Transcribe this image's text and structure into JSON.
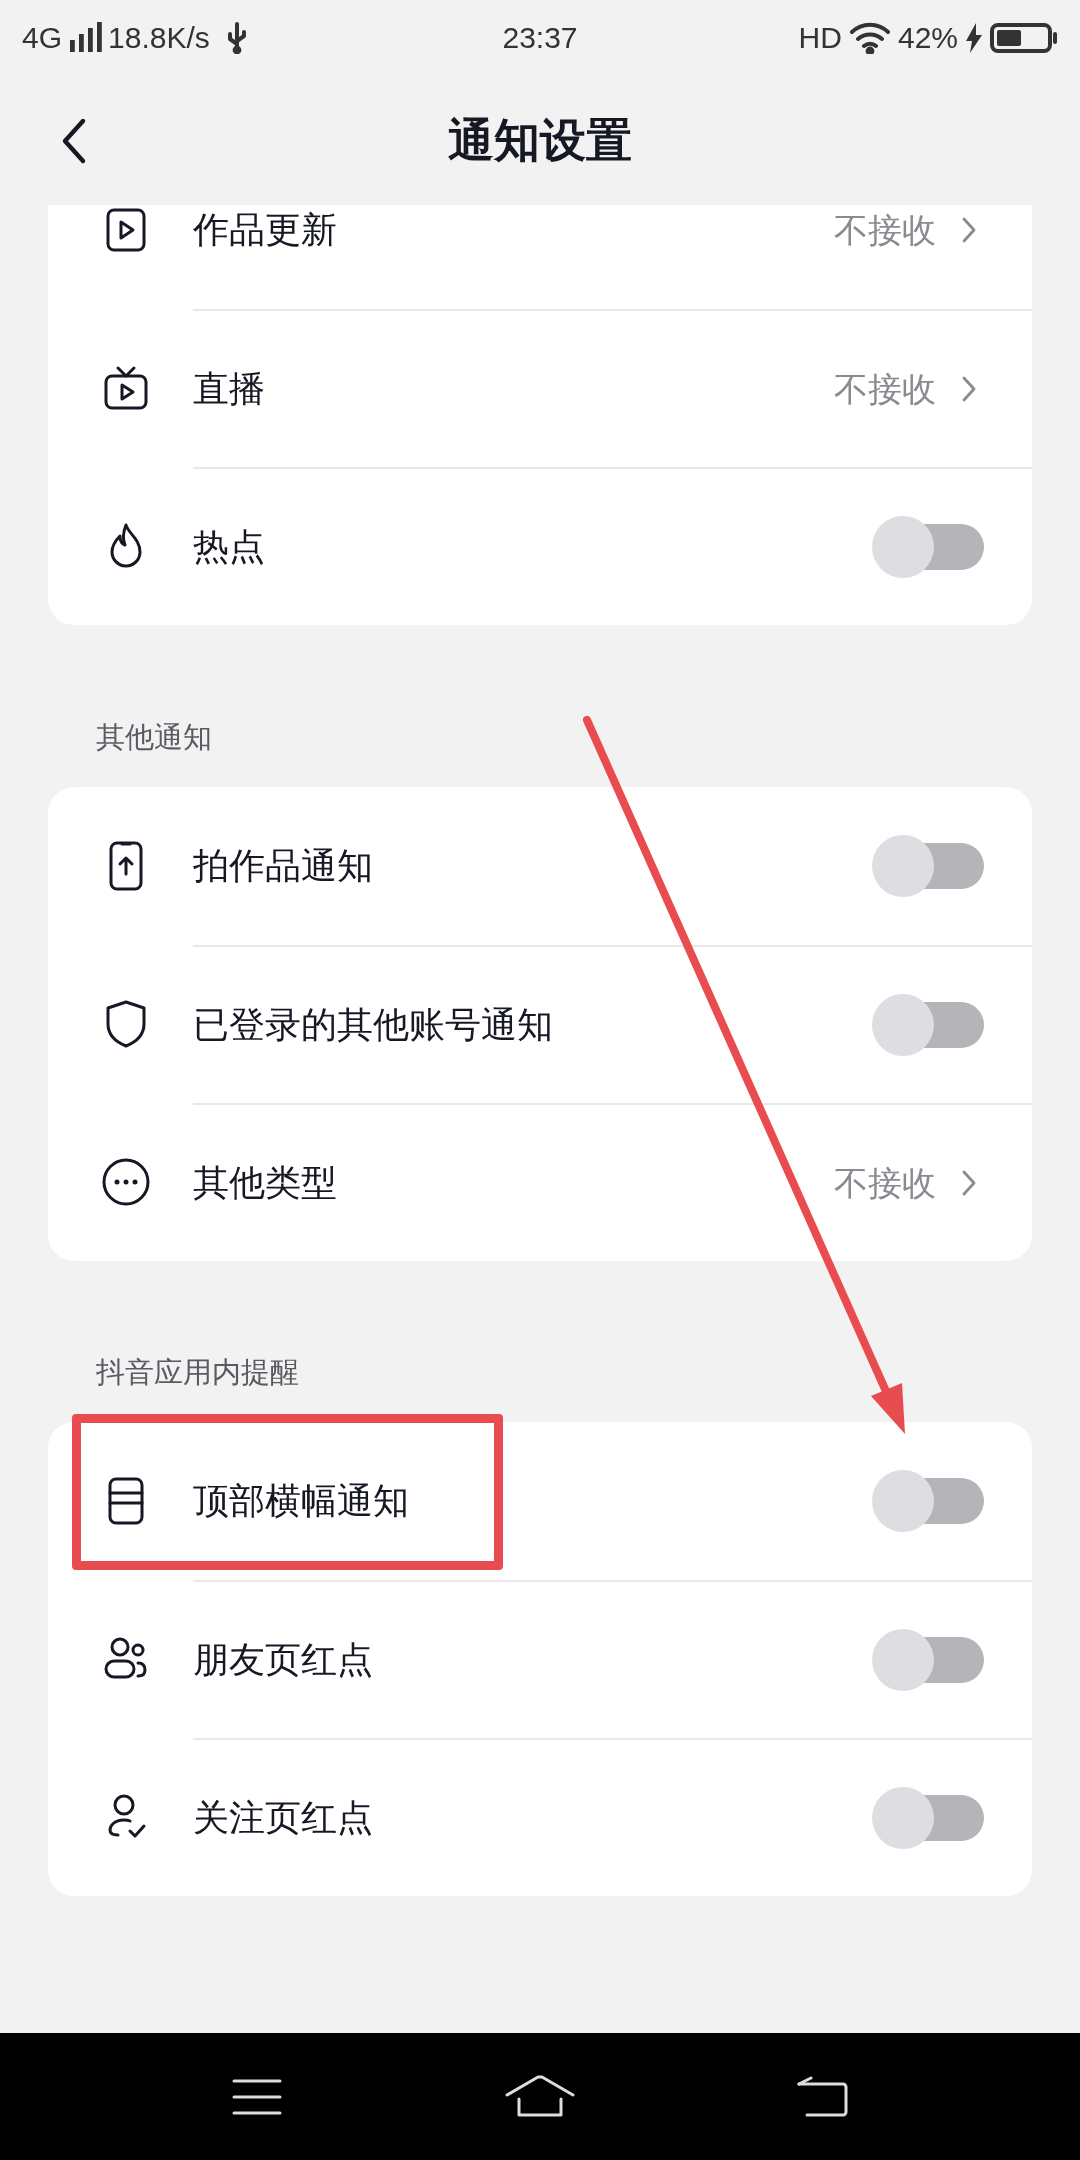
{
  "status_bar": {
    "network": "4G",
    "speed": "18.8K/s",
    "time": "23:37",
    "hd": "HD",
    "battery": "42%"
  },
  "header": {
    "title": "通知设置"
  },
  "sections": [
    {
      "items": [
        {
          "kind": "link",
          "label": "作品更新",
          "value": "不接收"
        },
        {
          "kind": "link",
          "label": "直播",
          "value": "不接收"
        },
        {
          "kind": "toggle",
          "label": "热点",
          "on": false
        }
      ]
    },
    {
      "title": "其他通知",
      "items": [
        {
          "kind": "toggle",
          "label": "拍作品通知",
          "on": false
        },
        {
          "kind": "toggle",
          "label": "已登录的其他账号通知",
          "on": false
        },
        {
          "kind": "link",
          "label": "其他类型",
          "value": "不接收"
        }
      ]
    },
    {
      "title": "抖音应用内提醒",
      "items": [
        {
          "kind": "toggle",
          "label": "顶部横幅通知",
          "on": false,
          "highlighted": true
        },
        {
          "kind": "toggle",
          "label": "朋友页红点",
          "on": false,
          "highlighted": false
        },
        {
          "kind": "toggle",
          "label": "关注页红点",
          "on": false,
          "highlighted": false
        }
      ]
    }
  ]
}
